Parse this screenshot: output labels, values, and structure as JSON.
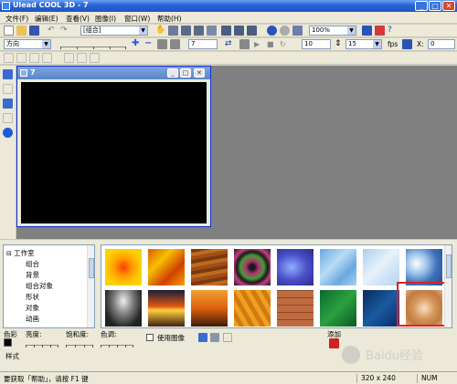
{
  "window": {
    "title": "Ulead COOL 3D - 7",
    "buttons": [
      "_",
      "□",
      "✕"
    ]
  },
  "menu": [
    "文件(F)",
    "编辑(E)",
    "查看(V)",
    "图像(I)",
    "窗口(W)",
    "帮助(H)"
  ],
  "toolbar1": {
    "object_combo": "[组合]",
    "zoom_combo": "100%"
  },
  "toolbar2": {
    "mode_combo": "方向",
    "frame_value": "7",
    "fps_label": "fps",
    "frames_value": "10",
    "fps_value": "15",
    "x_label": "X:",
    "x_value": "0"
  },
  "document": {
    "title": "7"
  },
  "tree": [
    "工作室",
    "组合",
    "背景",
    "组合对象",
    "形状",
    "对象",
    "动画"
  ],
  "controls": {
    "color_label": "色彩",
    "brightness_label": "亮度:",
    "saturation_label": "饱和度:",
    "hue_label": "色调:",
    "use_image_label": "使用图像",
    "add_label": "添加",
    "style_label": "样式"
  },
  "status": {
    "help": "要获取「帮助」，请按 F1 键",
    "size": "320 x 240",
    "num": "NUM"
  },
  "watermark": "Baidu经验",
  "icons": [
    "new-icon",
    "open-icon",
    "save-icon",
    "undo-icon",
    "redo-icon",
    "hand-icon",
    "rotate-icon",
    "zoom-icon",
    "help-icon",
    "play-icon",
    "stop-icon",
    "layer-icon",
    "add-gallery-icon"
  ],
  "colors": {
    "highlight": "#e02020",
    "title_bar": "#2b66d6",
    "canvas": "#000000"
  }
}
